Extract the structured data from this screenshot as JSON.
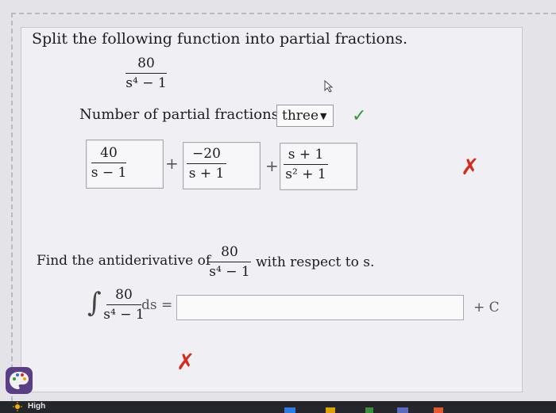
{
  "question": {
    "instruction": "Split the following function into partial fractions.",
    "function": {
      "numerator": "80",
      "denominator": "s⁴ − 1"
    },
    "count_label": "Number of partial fractions:",
    "count_selected": "three",
    "terms": [
      {
        "numerator": "40",
        "denominator": "s − 1"
      },
      {
        "numerator": "−20",
        "denominator": "s + 1"
      },
      {
        "numerator": "s + 1",
        "denominator": "s² + 1"
      }
    ],
    "plus": "+"
  },
  "antiderivative": {
    "prefix": "Find the antiderivative of",
    "suffix": "with respect to s.",
    "function": {
      "numerator": "80",
      "denominator": "s⁴ − 1"
    },
    "integral_sign": "∫",
    "ds": "ds =",
    "input_value": "",
    "constant": "+ C"
  },
  "feedback": {
    "check": "✓",
    "wrong": "✗"
  },
  "taskbar": {
    "status_label": "High"
  },
  "colors": {
    "correct": "#2e9a39",
    "incorrect": "#d52b1e"
  }
}
